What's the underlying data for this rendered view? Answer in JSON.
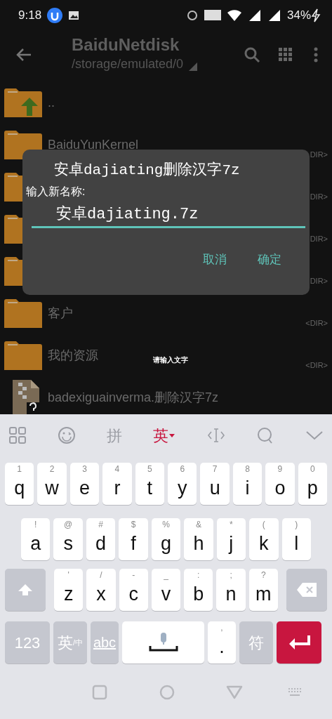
{
  "status_bar": {
    "time": "9:18",
    "battery": "34%"
  },
  "app_bar": {
    "title": "BaiduNetdisk",
    "path": "/storage/emulated/0"
  },
  "files": [
    {
      "kind": "up",
      "name": ".."
    },
    {
      "kind": "folder",
      "name": "BaiduYunKernel",
      "size": "DIR>"
    },
    {
      "kind": "folder",
      "size": "DIR>"
    },
    {
      "kind": "folder",
      "size": "DIR>"
    },
    {
      "kind": "folder",
      "size": "DIR>"
    },
    {
      "kind": "folder",
      "name": "客户",
      "size": "<DIR>"
    },
    {
      "kind": "folder",
      "name": "我的资源",
      "size": "<DIR>"
    },
    {
      "kind": "archive",
      "name": "badexiguainverma.删除汉字7z"
    }
  ],
  "toast": "请输入文字",
  "dialog": {
    "title": "安卓dajiating删除汉字7z",
    "label": "输入新名称:",
    "value": "安卓dajiating.7z",
    "buttons": [
      "取消",
      "确定"
    ]
  },
  "keyboard": {
    "toolbar": [
      {
        "kind": "grid",
        "selected": false
      },
      {
        "kind": "emoji",
        "selected": false
      },
      {
        "kind": "text",
        "label": "拼",
        "selected": false
      },
      {
        "kind": "text",
        "label": "英",
        "selected": true
      },
      {
        "kind": "cursor",
        "selected": false
      },
      {
        "kind": "search",
        "selected": false
      },
      {
        "kind": "collapse",
        "selected": false
      }
    ],
    "rows": [
      [
        {
          "kind": "letter",
          "hint": "1",
          "label": "q"
        },
        {
          "kind": "letter",
          "hint": "2",
          "label": "w"
        },
        {
          "kind": "letter",
          "hint": "3",
          "label": "e"
        },
        {
          "kind": "letter",
          "hint": "4",
          "label": "r"
        },
        {
          "kind": "letter",
          "hint": "5",
          "label": "t"
        },
        {
          "kind": "letter",
          "hint": "6",
          "label": "y"
        },
        {
          "kind": "letter",
          "hint": "7",
          "label": "u"
        },
        {
          "kind": "letter",
          "hint": "8",
          "label": "i"
        },
        {
          "kind": "letter",
          "hint": "9",
          "label": "o"
        },
        {
          "kind": "letter",
          "hint": "0",
          "label": "p"
        }
      ],
      [
        {
          "kind": "letter",
          "hint": "!",
          "label": "a"
        },
        {
          "kind": "letter",
          "hint": "@",
          "label": "s"
        },
        {
          "kind": "letter",
          "hint": "#",
          "label": "d"
        },
        {
          "kind": "letter",
          "hint": "$",
          "label": "f"
        },
        {
          "kind": "letter",
          "hint": "%",
          "label": "g"
        },
        {
          "kind": "letter",
          "hint": "&",
          "label": "h"
        },
        {
          "kind": "letter",
          "hint": "*",
          "label": "j"
        },
        {
          "kind": "letter",
          "hint": "(",
          "label": "k"
        },
        {
          "kind": "letter",
          "hint": ")",
          "label": "l"
        }
      ],
      [
        {
          "kind": "shift"
        },
        {
          "kind": "letter",
          "hint": "'",
          "label": "z"
        },
        {
          "kind": "letter",
          "hint": "/",
          "label": "x"
        },
        {
          "kind": "letter",
          "hint": "-",
          "label": "c"
        },
        {
          "kind": "letter",
          "hint": "_",
          "label": "v"
        },
        {
          "kind": "letter",
          "hint": ":",
          "label": "b"
        },
        {
          "kind": "letter",
          "hint": ";",
          "label": "n"
        },
        {
          "kind": "letter",
          "hint": "?",
          "label": "m"
        },
        {
          "kind": "backspace"
        }
      ],
      [
        {
          "kind": "numbers",
          "label": "123"
        },
        {
          "kind": "lang",
          "label": "英",
          "sub": "/中"
        },
        {
          "kind": "abc",
          "label": "abc"
        },
        {
          "kind": "space"
        },
        {
          "kind": "punct",
          "hint": ",",
          "label": "."
        },
        {
          "kind": "symbols",
          "label": "符"
        },
        {
          "kind": "enter"
        }
      ]
    ]
  }
}
